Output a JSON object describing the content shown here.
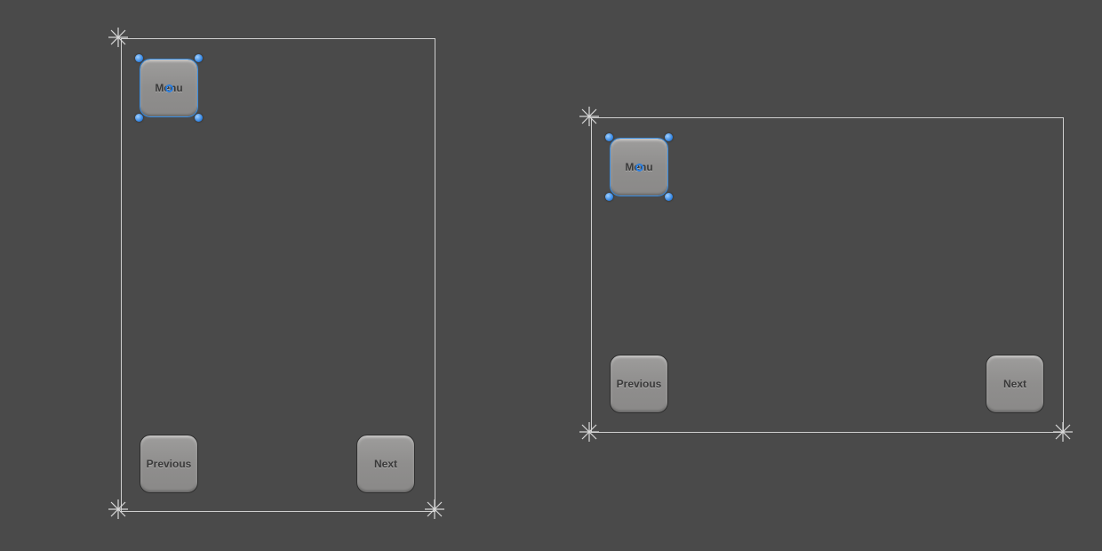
{
  "canvases": {
    "portrait": {
      "buttons": {
        "menu": {
          "label": "Menu"
        },
        "previous": {
          "label": "Previous"
        },
        "next": {
          "label": "Next"
        }
      },
      "selected_button": "menu"
    },
    "landscape": {
      "buttons": {
        "menu": {
          "label": "Menu"
        },
        "previous": {
          "label": "Previous"
        },
        "next": {
          "label": "Next"
        }
      },
      "selected_button": "menu"
    }
  }
}
